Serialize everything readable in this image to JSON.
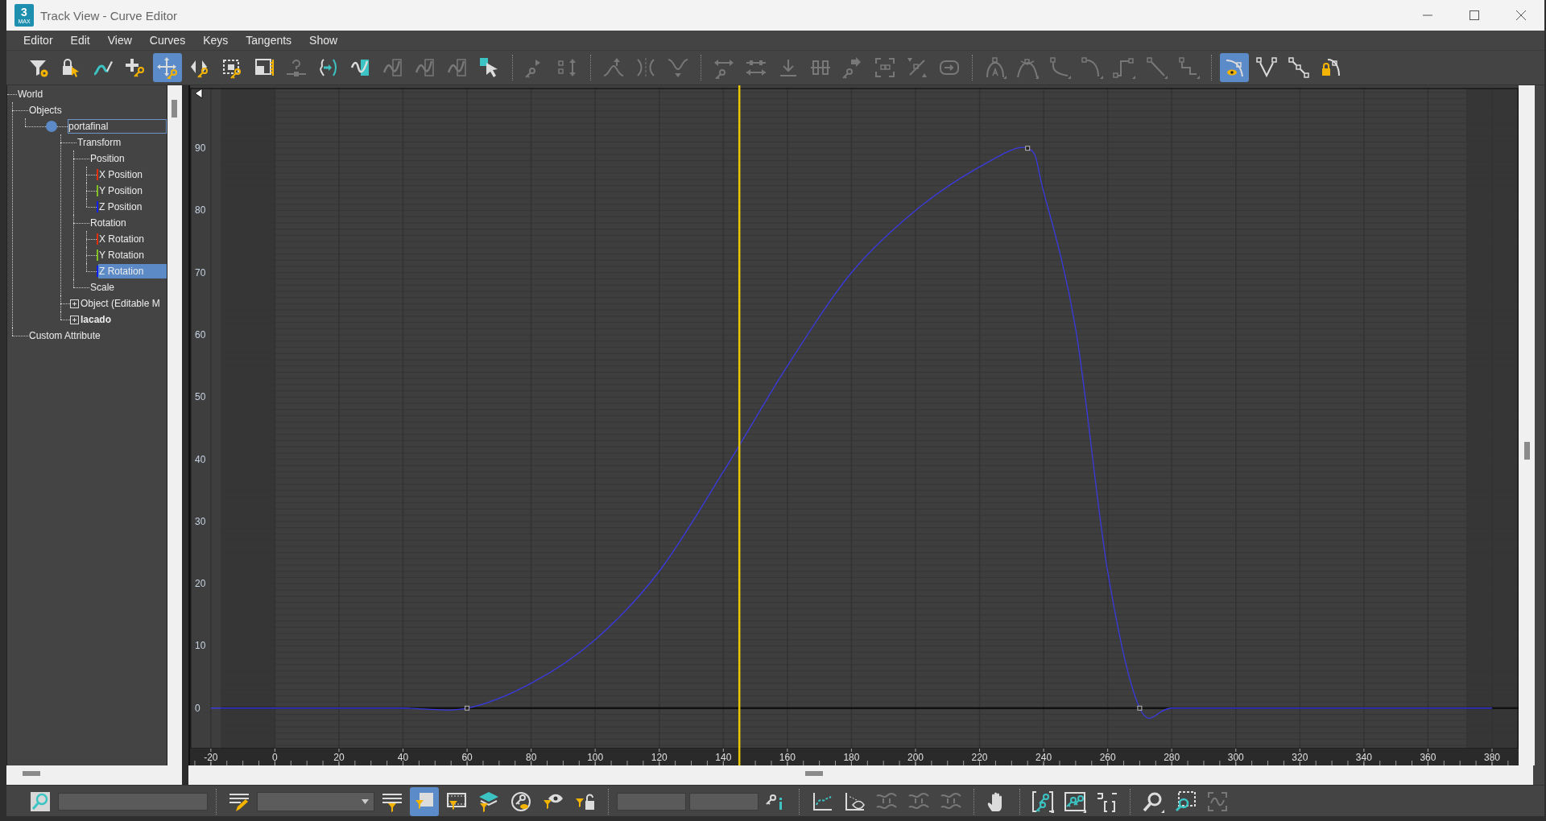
{
  "window": {
    "title": "Track View - Curve Editor",
    "logo": {
      "number": "3",
      "label": "MAX"
    }
  },
  "menu": [
    "Editor",
    "Edit",
    "View",
    "Curves",
    "Keys",
    "Tangents",
    "Show"
  ],
  "toolbar": [
    {
      "selected": false,
      "disabled": false
    },
    {
      "selected": false,
      "disabled": false
    },
    {
      "selected": false,
      "disabled": false
    },
    {
      "selected": false,
      "disabled": false
    },
    {
      "selected": true,
      "disabled": false
    },
    {
      "selected": false,
      "disabled": false
    },
    {
      "selected": false,
      "disabled": false
    },
    {
      "selected": false,
      "disabled": false
    },
    {
      "selected": false,
      "disabled": true
    },
    {
      "selected": false,
      "disabled": false
    },
    {
      "selected": false,
      "disabled": false
    },
    {
      "selected": false,
      "disabled": true
    },
    {
      "selected": false,
      "disabled": true
    },
    {
      "selected": false,
      "disabled": true
    },
    {
      "selected": false,
      "disabled": false
    },
    {
      "selected": false,
      "disabled": true
    },
    {
      "selected": false,
      "disabled": true
    },
    {
      "selected": false,
      "disabled": true
    },
    {
      "selected": false,
      "disabled": true
    },
    {
      "selected": false,
      "disabled": true
    },
    {
      "selected": false,
      "disabled": true
    },
    {
      "selected": false,
      "disabled": true
    },
    {
      "selected": false,
      "disabled": true
    },
    {
      "selected": false,
      "disabled": true
    },
    {
      "selected": false,
      "disabled": true
    },
    {
      "selected": false,
      "disabled": true
    },
    {
      "selected": false,
      "disabled": true
    },
    {
      "selected": false,
      "disabled": true
    },
    {
      "selected": false,
      "disabled": true
    },
    {
      "selected": false,
      "disabled": true
    },
    {
      "selected": false,
      "disabled": true
    },
    {
      "selected": false,
      "disabled": true
    },
    {
      "selected": false,
      "disabled": true
    },
    {
      "selected": false,
      "disabled": true
    },
    {
      "selected": false,
      "disabled": true
    },
    {
      "selected": true,
      "disabled": false
    },
    {
      "selected": false,
      "disabled": false
    },
    {
      "selected": false,
      "disabled": false
    },
    {
      "selected": false,
      "disabled": false
    }
  ],
  "tree": [
    {
      "label": "World",
      "selected": false,
      "children": [
        {
          "label": "Objects",
          "selected": false,
          "children": [
            {
              "label": "portafinal",
              "kind": "object",
              "selected": false,
              "focused": true,
              "children": [
                {
                  "label": "Transform",
                  "selected": false,
                  "children": [
                    {
                      "label": "Position",
                      "selected": false,
                      "children": [
                        {
                          "label": "X Position",
                          "selected": false,
                          "color": "#e03010"
                        },
                        {
                          "label": "Y Position",
                          "selected": false,
                          "color": "#80c020"
                        },
                        {
                          "label": "Z Position",
                          "selected": false,
                          "color": "#1020f0"
                        }
                      ]
                    },
                    {
                      "label": "Rotation",
                      "selected": false,
                      "children": [
                        {
                          "label": "X Rotation",
                          "selected": false,
                          "color": "#e03010"
                        },
                        {
                          "label": "Y Rotation",
                          "selected": false,
                          "color": "#80c020"
                        },
                        {
                          "label": "Z Rotation",
                          "selected": true,
                          "color": "#1020f0"
                        }
                      ]
                    },
                    {
                      "label": "Scale",
                      "selected": false
                    }
                  ]
                },
                {
                  "label": "Object (Editable M",
                  "selected": false,
                  "expanded": false
                },
                {
                  "label": "lacado",
                  "selected": false,
                  "expanded": false,
                  "bold": true
                }
              ]
            }
          ]
        },
        {
          "label": "Custom Attribute",
          "selected": false
        }
      ]
    }
  ],
  "graph": {
    "chart_data": {
      "type": "line",
      "x": [
        -20,
        0,
        20,
        40,
        60,
        80,
        100,
        120,
        140,
        160,
        180,
        200,
        220,
        235,
        240,
        250,
        260,
        270,
        280,
        300,
        320,
        340,
        360,
        380
      ],
      "series": [
        {
          "color": "#3a3ae0",
          "values": [
            0,
            0,
            0,
            0,
            0,
            4,
            11,
            22,
            38,
            55,
            70,
            80,
            87,
            90,
            83,
            61,
            22,
            0,
            0,
            0,
            0,
            0,
            0,
            0
          ]
        }
      ],
      "grid": true,
      "xlim": [
        -26.5,
        388.3
      ],
      "ylim": [
        -6.5,
        99.6
      ],
      "xticks": [
        -20,
        0,
        20,
        40,
        60,
        80,
        100,
        120,
        140,
        160,
        180,
        200,
        220,
        240,
        260,
        280,
        300,
        320,
        340,
        360,
        380
      ],
      "yticks": [
        0,
        10,
        20,
        30,
        40,
        50,
        60,
        70,
        80,
        90
      ],
      "ref_lines": [
        {
          "axis": "x",
          "value": 145,
          "color": "#e8c800"
        }
      ],
      "bands": [
        {
          "axis": "x",
          "from": -17,
          "to": 0
        },
        {
          "axis": "x",
          "from": 372,
          "to": 388
        }
      ]
    }
  },
  "bottom_toolbar": [
    {
      "selected": false,
      "disabled": false
    },
    {
      "selected": false,
      "disabled": false
    },
    {
      "selected": false,
      "disabled": false
    },
    {
      "selected": true,
      "disabled": false
    },
    {
      "selected": false,
      "disabled": false
    },
    {
      "selected": false,
      "disabled": false
    },
    {
      "selected": false,
      "disabled": false
    },
    {
      "selected": false,
      "disabled": false
    },
    {
      "selected": false,
      "disabled": false
    },
    {
      "selected": false,
      "disabled": false
    },
    {
      "selected": false,
      "disabled": false
    },
    {
      "selected": false,
      "disabled": false
    },
    {
      "selected": false,
      "disabled": true
    },
    {
      "selected": false,
      "disabled": true
    },
    {
      "selected": false,
      "disabled": true
    },
    {
      "selected": false,
      "disabled": false
    },
    {
      "selected": false,
      "disabled": false
    },
    {
      "selected": false,
      "disabled": false
    },
    {
      "selected": false,
      "disabled": false
    },
    {
      "selected": false,
      "disabled": false
    },
    {
      "selected": false,
      "disabled": false
    },
    {
      "selected": false,
      "disabled": true
    }
  ]
}
